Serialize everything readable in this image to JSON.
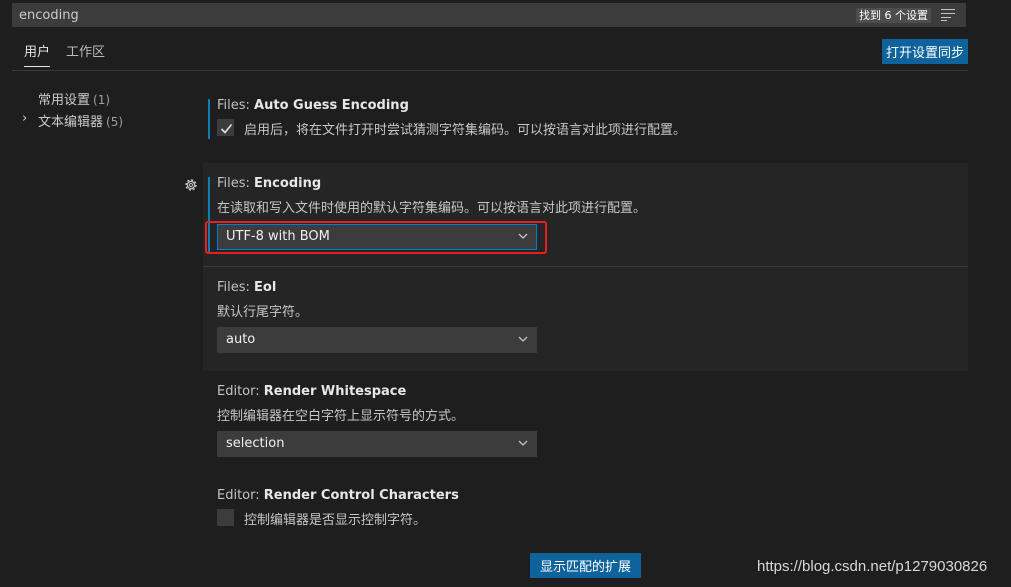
{
  "search": {
    "value": "encoding",
    "result_count": "找到 6 个设置",
    "filter_icon": "filter-list-icon"
  },
  "tabs": [
    {
      "label": "用户",
      "active": true
    },
    {
      "label": "工作区",
      "active": false
    }
  ],
  "sync_button": "打开设置同步",
  "toc": [
    {
      "label": "常用设置",
      "count": "(1)",
      "expandable": false
    },
    {
      "label": "文本编辑器",
      "count": "(5)",
      "expandable": true
    }
  ],
  "settings": [
    {
      "category": "Files: ",
      "name": "Auto Guess Encoding",
      "type": "checkbox",
      "checked": true,
      "description": "启用后，将在文件打开时尝试猜测字符集编码。可以按语言对此项进行配置。"
    },
    {
      "category": "Files: ",
      "name": "Encoding",
      "type": "dropdown",
      "value": "UTF-8 with BOM",
      "description": "在读取和写入文件时使用的默认字符集编码。可以按语言对此项进行配置。"
    },
    {
      "category": "Files: ",
      "name": "Eol",
      "type": "dropdown",
      "value": "auto",
      "description": "默认行尾字符。"
    },
    {
      "category": "Editor: ",
      "name": "Render Whitespace",
      "type": "dropdown",
      "value": "selection",
      "description": "控制编辑器在空白字符上显示符号的方式。"
    },
    {
      "category": "Editor: ",
      "name": "Render Control Characters",
      "type": "checkbox",
      "checked": false,
      "description": "控制编辑器是否显示控制字符。"
    }
  ],
  "show_extensions_button": "显示匹配的扩展",
  "watermark": "https://blog.csdn.net/p1279030826",
  "colors": {
    "accent": "#0e639c",
    "highlight": "#e52020",
    "background": "#1e1e1e",
    "panel": "#252526"
  }
}
